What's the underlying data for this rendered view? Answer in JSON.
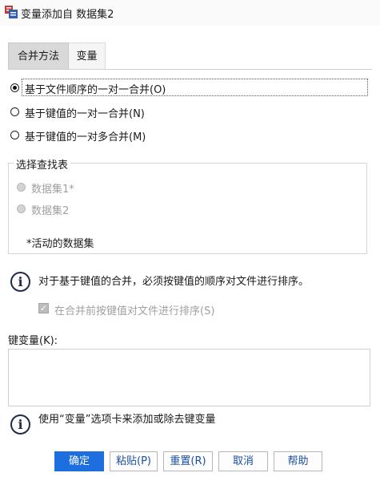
{
  "window": {
    "title": "变量添加自 数据集2"
  },
  "tabs": [
    {
      "label": "合并方法",
      "selected": true
    },
    {
      "label": "变量",
      "selected": false
    }
  ],
  "merge_methods": [
    {
      "label": "基于文件顺序的一对一合并(O)",
      "selected": true
    },
    {
      "label": "基于键值的一对一合并(N)",
      "selected": false
    },
    {
      "label": "基于键值的一对多合并(M)",
      "selected": false
    }
  ],
  "lookup_table": {
    "legend": "选择查找表",
    "options": [
      {
        "label": "数据集1*",
        "enabled": false
      },
      {
        "label": "数据集2",
        "enabled": false
      }
    ],
    "note": "*活动的数据集"
  },
  "info_sort": "对于基于键值的合并，必须按键值的顺序对文件进行排序。",
  "sort_checkbox": {
    "label": "在合并前按键值对文件进行排序(S)",
    "checked": true,
    "enabled": false
  },
  "key_variables": {
    "label": "键变量(K):",
    "items": []
  },
  "info_tab": "使用“变量”选项卡来添加或除去键变量",
  "buttons": {
    "ok": "确定",
    "paste": "粘贴(P)",
    "reset": "重置(R)",
    "cancel": "取消",
    "help": "帮助"
  },
  "colors": {
    "primary_button": "#1d6fe0",
    "info_icon": "#1f2d4a"
  }
}
